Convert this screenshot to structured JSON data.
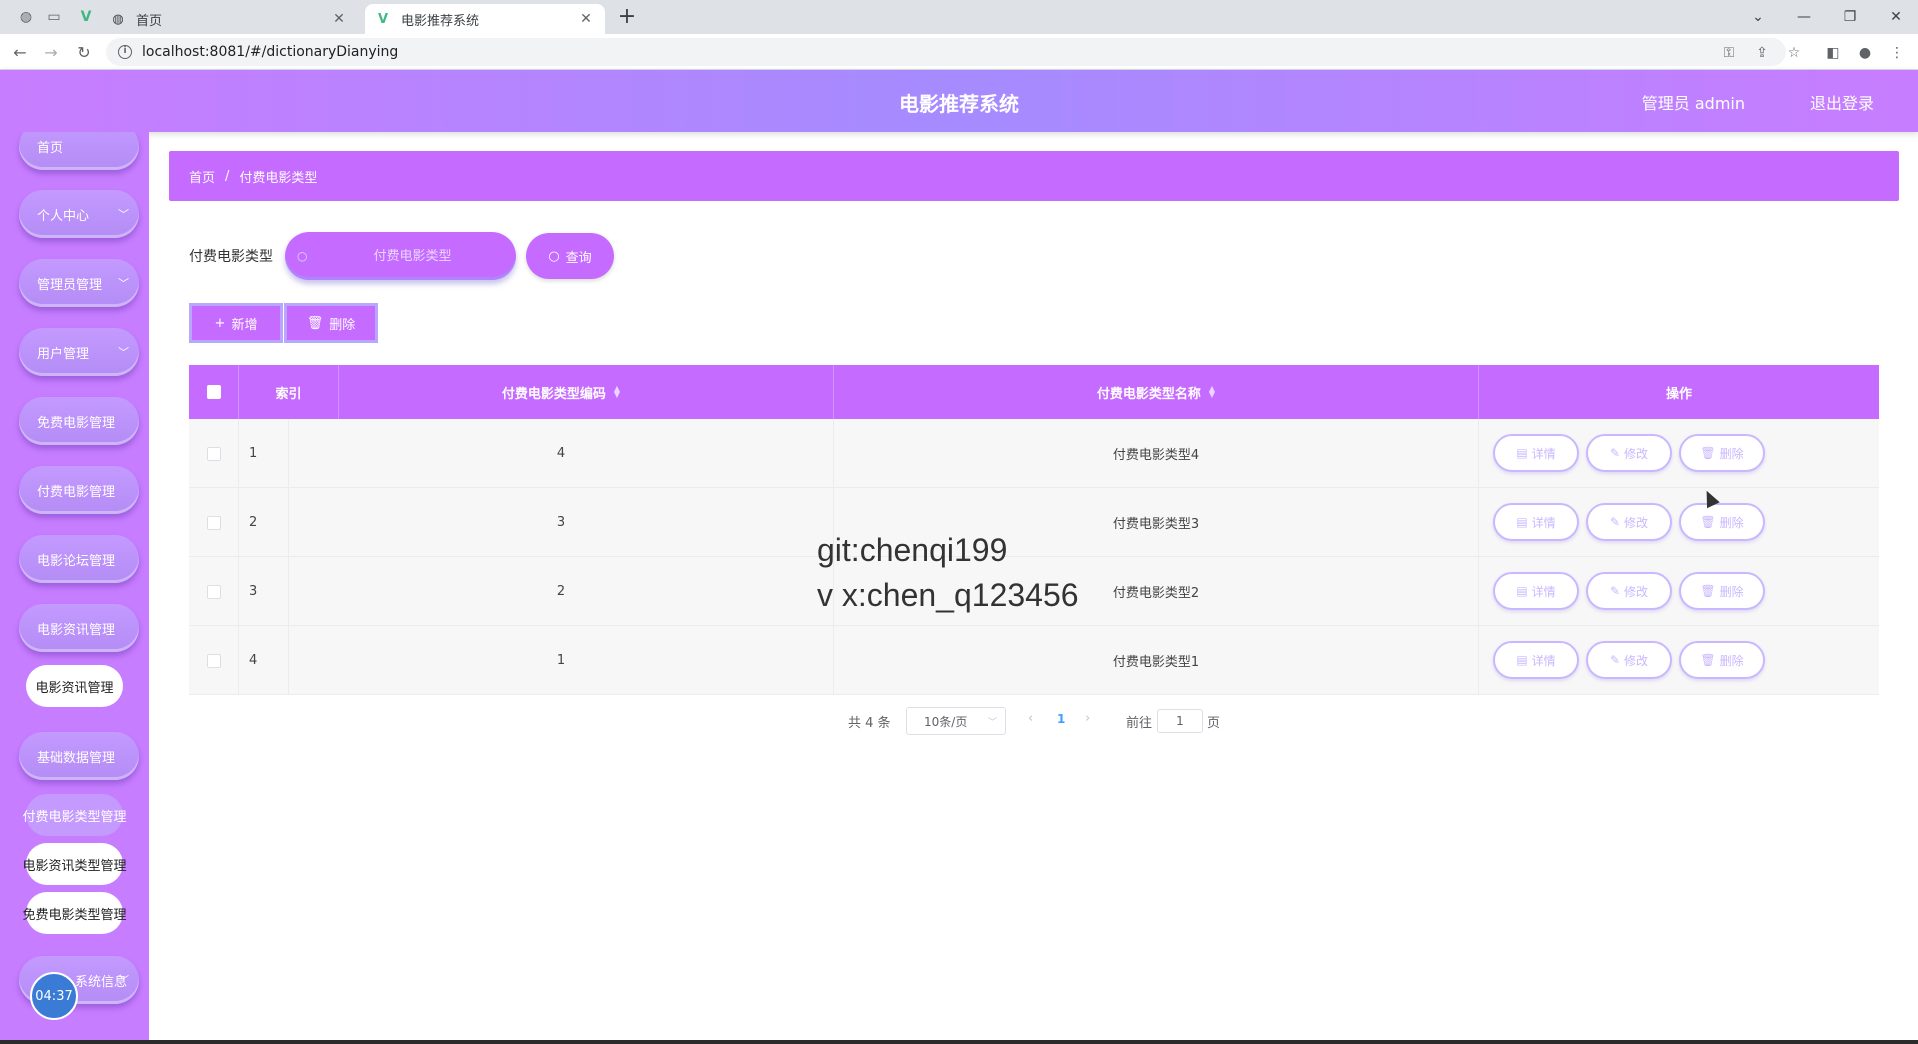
{
  "browser": {
    "tabs": [
      {
        "title": "首页",
        "icon": "globe-icon"
      },
      {
        "title": "电影推荐系统",
        "icon": "vue-icon"
      }
    ],
    "url": "localhost:8081/#/dictionaryDianying"
  },
  "header": {
    "title": "电影推荐系统",
    "user": "管理员 admin",
    "logout": "退出登录"
  },
  "sidebar": {
    "items": [
      {
        "label": "首页"
      },
      {
        "label": "个人中心"
      },
      {
        "label": "管理员管理"
      },
      {
        "label": "用户管理"
      },
      {
        "label": "免费电影管理"
      },
      {
        "label": "付费电影管理"
      },
      {
        "label": "电影论坛管理"
      },
      {
        "label": "电影资讯管理"
      },
      {
        "label": "基础数据管理"
      },
      {
        "label": "系统信息"
      }
    ],
    "subitems": {
      "news": "电影资讯管理",
      "paid_type": "付费电影类型管理",
      "news_type": "电影资讯类型管理",
      "free_type": "免费电影类型管理"
    },
    "clock": "04:37"
  },
  "breadcrumb": {
    "home": "首页",
    "separator": "/",
    "current": "付费电影类型"
  },
  "search": {
    "label": "付费电影类型",
    "placeholder": "付费电影类型",
    "button": "查询"
  },
  "actions": {
    "add": "新增",
    "delete": "删除"
  },
  "table": {
    "headers": {
      "index": "索引",
      "code": "付费电影类型编码",
      "name": "付费电影类型名称",
      "ops": "操作"
    },
    "rows": [
      {
        "index": "1",
        "code": "4",
        "name": "付费电影类型4"
      },
      {
        "index": "2",
        "code": "3",
        "name": "付费电影类型3"
      },
      {
        "index": "3",
        "code": "2",
        "name": "付费电影类型2"
      },
      {
        "index": "4",
        "code": "1",
        "name": "付费电影类型1"
      }
    ],
    "op_labels": {
      "detail": "详情",
      "edit": "修改",
      "delete": "删除"
    }
  },
  "pagination": {
    "total": "共 4 条",
    "page_size": "10条/页",
    "current_page": "1",
    "goto_label": "前往",
    "goto_value": "1",
    "goto_unit": "页"
  },
  "watermark": {
    "line1": "git:chenqi199",
    "line2": "v x:chen_q123456"
  }
}
